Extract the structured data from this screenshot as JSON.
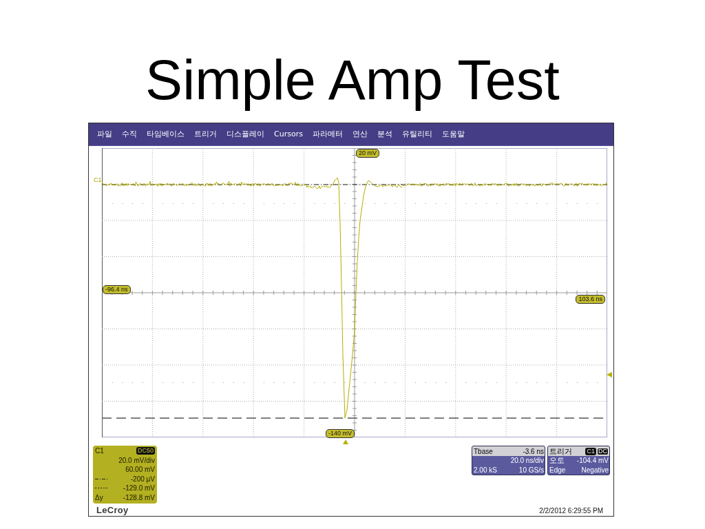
{
  "slide": {
    "title": "Simple Amp Test"
  },
  "scope": {
    "menu": [
      "파일",
      "수직",
      "타임베이스",
      "트리거",
      "디스플레이",
      "Cursors",
      "파라메터",
      "연산",
      "분석",
      "유틸리티",
      "도움말"
    ],
    "display": {
      "trace_label": "C1",
      "cursor_readouts": [
        {
          "kind": "top",
          "text": "20 mV"
        },
        {
          "kind": "left",
          "text": "-96.4 ns"
        },
        {
          "kind": "right",
          "text": "103.6 ns"
        },
        {
          "kind": "bottom",
          "text": "-140 mV"
        }
      ]
    },
    "channel": {
      "name": "C1",
      "coupling": "DC50",
      "rows": [
        {
          "kind": "plain",
          "value": "20.0 mV/div"
        },
        {
          "kind": "plain",
          "value": "60.00 mV"
        },
        {
          "kind": "dash-dot",
          "value": "-200 µV"
        },
        {
          "kind": "dotted",
          "value": "-129.0 mV"
        },
        {
          "kind": "labeled",
          "label": "Δy",
          "value": "-128.8 mV"
        }
      ]
    },
    "logo": "LeCroy",
    "timebase": {
      "title": "Tbase",
      "delay": "-3.6 ns",
      "scale": "20.0 ns/div",
      "samples": "2.00 kS",
      "rate": "10 GS/s"
    },
    "trigger": {
      "title": "트리거",
      "source": "C1",
      "coupling": "DC",
      "mode": "오토",
      "level": "-104.4 mV",
      "type": "Edge",
      "slope": "Negative"
    },
    "timestamp": "2/2/2012 6:29:55 PM"
  }
}
